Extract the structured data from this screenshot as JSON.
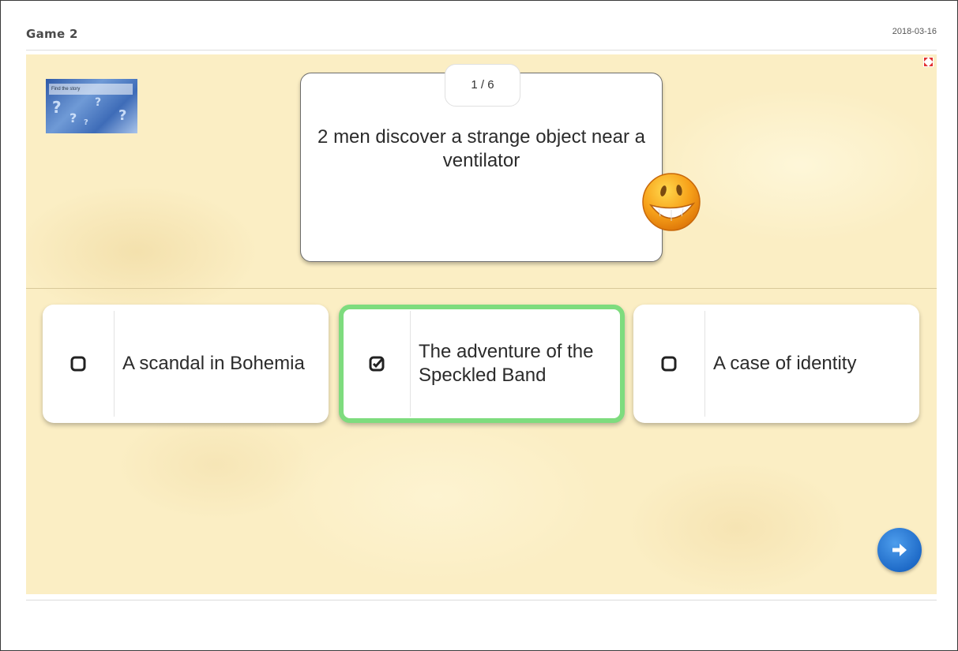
{
  "header": {
    "title": "Game 2",
    "date": "2018-03-16"
  },
  "thumbnail": {
    "label": "Find the story",
    "icon": "question-marks-image"
  },
  "question": {
    "counter": "1 / 6",
    "text": "2 men discover a strange object near a ventilator",
    "reaction_icon": "grinning-face-icon"
  },
  "answers": [
    {
      "label": "A scandal in Bohemia",
      "checked": false
    },
    {
      "label": "The adventure of the Speckled Band",
      "checked": true
    },
    {
      "label": "A case of identity",
      "checked": false
    }
  ],
  "controls": {
    "next_icon": "arrow-right-icon",
    "fullscreen_icon": "fullscreen-toggle-icon"
  },
  "colors": {
    "background": "#fbeec4",
    "selected_border": "#7edc7e",
    "next_button": "#1f6bc8"
  }
}
